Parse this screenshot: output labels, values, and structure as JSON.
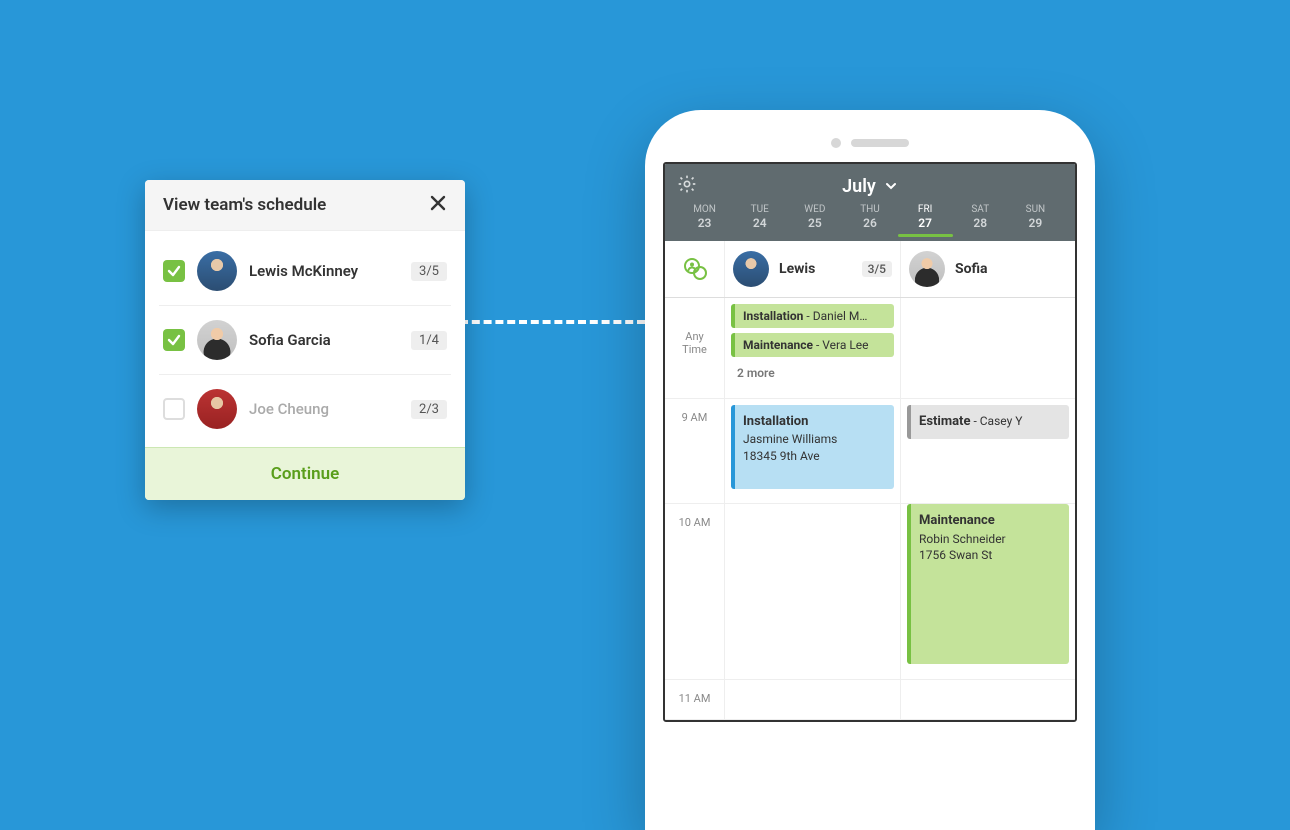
{
  "popover": {
    "title": "View team's schedule",
    "continue": "Continue",
    "members": [
      {
        "name": "Lewis McKinney",
        "ratio": "3/5",
        "checked": true,
        "avatar": "lewis"
      },
      {
        "name": "Sofia Garcia",
        "ratio": "1/4",
        "checked": true,
        "avatar": "sofia"
      },
      {
        "name": "Joe Cheung",
        "ratio": "2/3",
        "checked": false,
        "avatar": "joe"
      }
    ]
  },
  "calendar": {
    "month": "July",
    "days": [
      {
        "dow": "MON",
        "num": "23"
      },
      {
        "dow": "TUE",
        "num": "24"
      },
      {
        "dow": "WED",
        "num": "25"
      },
      {
        "dow": "THU",
        "num": "26"
      },
      {
        "dow": "FRI",
        "num": "27",
        "active": true
      },
      {
        "dow": "SAT",
        "num": "28"
      },
      {
        "dow": "SUN",
        "num": "29"
      }
    ],
    "columns": [
      {
        "name": "Lewis",
        "ratio": "3/5",
        "avatar": "lewis"
      },
      {
        "name": "Sofia",
        "avatar": "sofia"
      }
    ],
    "anytime_label_line1": "Any",
    "anytime_label_line2": "Time",
    "lewis_anytime": [
      {
        "type": "Installation",
        "who": "Daniel M…"
      },
      {
        "type": "Maintenance",
        "who": "Vera Lee"
      }
    ],
    "lewis_more": "2 more",
    "hours": [
      "9 AM",
      "10 AM",
      "11 AM"
    ],
    "lewis_9am": {
      "type": "Installation",
      "who": "Jasmine Williams",
      "addr": "18345 9th Ave"
    },
    "sofia_9am": {
      "type": "Estimate",
      "who": "Casey Y"
    },
    "sofia_10am": {
      "type": "Maintenance",
      "who": "Robin Schneider",
      "addr": "1756 Swan St"
    }
  }
}
